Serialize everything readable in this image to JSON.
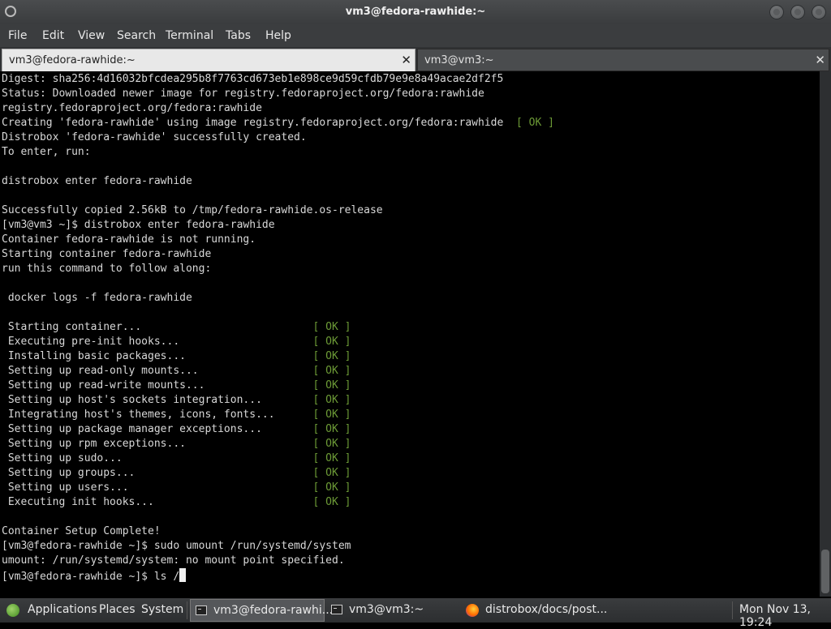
{
  "window": {
    "title": "vm3@fedora-rawhide:~"
  },
  "menu": [
    "File",
    "Edit",
    "View",
    "Search",
    "Terminal",
    "Tabs",
    "Help"
  ],
  "tabs": [
    {
      "label": "vm3@fedora-rawhide:~",
      "close": "✕"
    },
    {
      "label": "vm3@vm3:~",
      "close": "✕"
    }
  ],
  "terminal_lines": [
    {
      "text": "Digest: sha256:4d16032bfcdea295b8f7763cd673eb1e898ce9d59cfdb79e9e8a49acae2df2f5"
    },
    {
      "text": "Status: Downloaded newer image for registry.fedoraproject.org/fedora:rawhide"
    },
    {
      "text": "registry.fedoraproject.org/fedora:rawhide"
    },
    {
      "text": "Creating 'fedora-rawhide' using image registry.fedoraproject.org/fedora:rawhide  ",
      "ok": "[ OK ]"
    },
    {
      "text": "Distrobox 'fedora-rawhide' successfully created."
    },
    {
      "text": "To enter, run:"
    },
    {
      "text": ""
    },
    {
      "text": "distrobox enter fedora-rawhide"
    },
    {
      "text": ""
    },
    {
      "text": "Successfully copied 2.56kB to /tmp/fedora-rawhide.os-release"
    },
    {
      "text": "[vm3@vm3 ~]$ distrobox enter fedora-rawhide"
    },
    {
      "text": "Container fedora-rawhide is not running."
    },
    {
      "text": "Starting container fedora-rawhide"
    },
    {
      "text": "run this command to follow along:"
    },
    {
      "text": ""
    },
    {
      "text": " docker logs -f fedora-rawhide"
    },
    {
      "text": ""
    },
    {
      "text": " Starting container...                           ",
      "ok": "[ OK ]"
    },
    {
      "text": " Executing pre-init hooks...                     ",
      "ok": "[ OK ]"
    },
    {
      "text": " Installing basic packages...                    ",
      "ok": "[ OK ]"
    },
    {
      "text": " Setting up read-only mounts...                  ",
      "ok": "[ OK ]"
    },
    {
      "text": " Setting up read-write mounts...                 ",
      "ok": "[ OK ]"
    },
    {
      "text": " Setting up host's sockets integration...        ",
      "ok": "[ OK ]"
    },
    {
      "text": " Integrating host's themes, icons, fonts...      ",
      "ok": "[ OK ]"
    },
    {
      "text": " Setting up package manager exceptions...        ",
      "ok": "[ OK ]"
    },
    {
      "text": " Setting up rpm exceptions...                    ",
      "ok": "[ OK ]"
    },
    {
      "text": " Setting up sudo...                              ",
      "ok": "[ OK ]"
    },
    {
      "text": " Setting up groups...                            ",
      "ok": "[ OK ]"
    },
    {
      "text": " Setting up users...                             ",
      "ok": "[ OK ]"
    },
    {
      "text": " Executing init hooks...                         ",
      "ok": "[ OK ]"
    },
    {
      "text": ""
    },
    {
      "text": "Container Setup Complete!"
    },
    {
      "text": "[vm3@fedora-rawhide ~]$ sudo umount /run/systemd/system"
    },
    {
      "text": "umount: /run/systemd/system: no mount point specified."
    },
    {
      "text": "[vm3@fedora-rawhide ~]$ ls /",
      "cursor": true
    }
  ],
  "taskbar": {
    "applications": "Applications",
    "places": "Places",
    "system": "System",
    "tasks": [
      "vm3@fedora-rawhi...",
      "vm3@vm3:~",
      "distrobox/docs/post..."
    ],
    "clock": "Mon Nov 13, 19:24"
  },
  "colors": {
    "ok": "#6c9a36",
    "terminal_bg": "#000000",
    "terminal_fg": "#d8d8d8"
  }
}
